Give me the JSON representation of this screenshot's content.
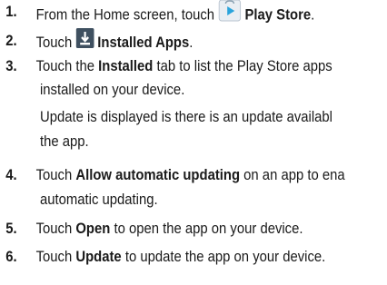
{
  "steps": [
    {
      "num": "1.",
      "pre": "From the Home screen, touch ",
      "icon": "play-store-icon",
      "bold": "Play Store",
      "post": "."
    },
    {
      "num": "2.",
      "pre": "Touch ",
      "icon": "installed-apps-download-icon",
      "bold": "Installed Apps",
      "post": "."
    },
    {
      "num": "3.",
      "pre": "Touch the ",
      "bold": "Installed",
      "post": " tab to list the Play Store apps",
      "line2": "installed on your device.",
      "line3": "Update is displayed is there is an update availabl",
      "line4": "the app."
    },
    {
      "num": "4.",
      "pre": "Touch ",
      "bold": "Allow automatic updating",
      "post": " on an app to ena",
      "line2": "automatic updating."
    },
    {
      "num": "5.",
      "pre": "Touch ",
      "bold": "Open",
      "post": " to open the app on your device."
    },
    {
      "num": "6.",
      "pre": "Touch ",
      "bold": "Update",
      "post": " to update the app on your device."
    }
  ],
  "colors": {
    "text": "#1a1a1a",
    "play_store_bg": "#e9eef3",
    "play_store_triangle": "#2aa4dc",
    "download_bg": "#3f5060"
  }
}
